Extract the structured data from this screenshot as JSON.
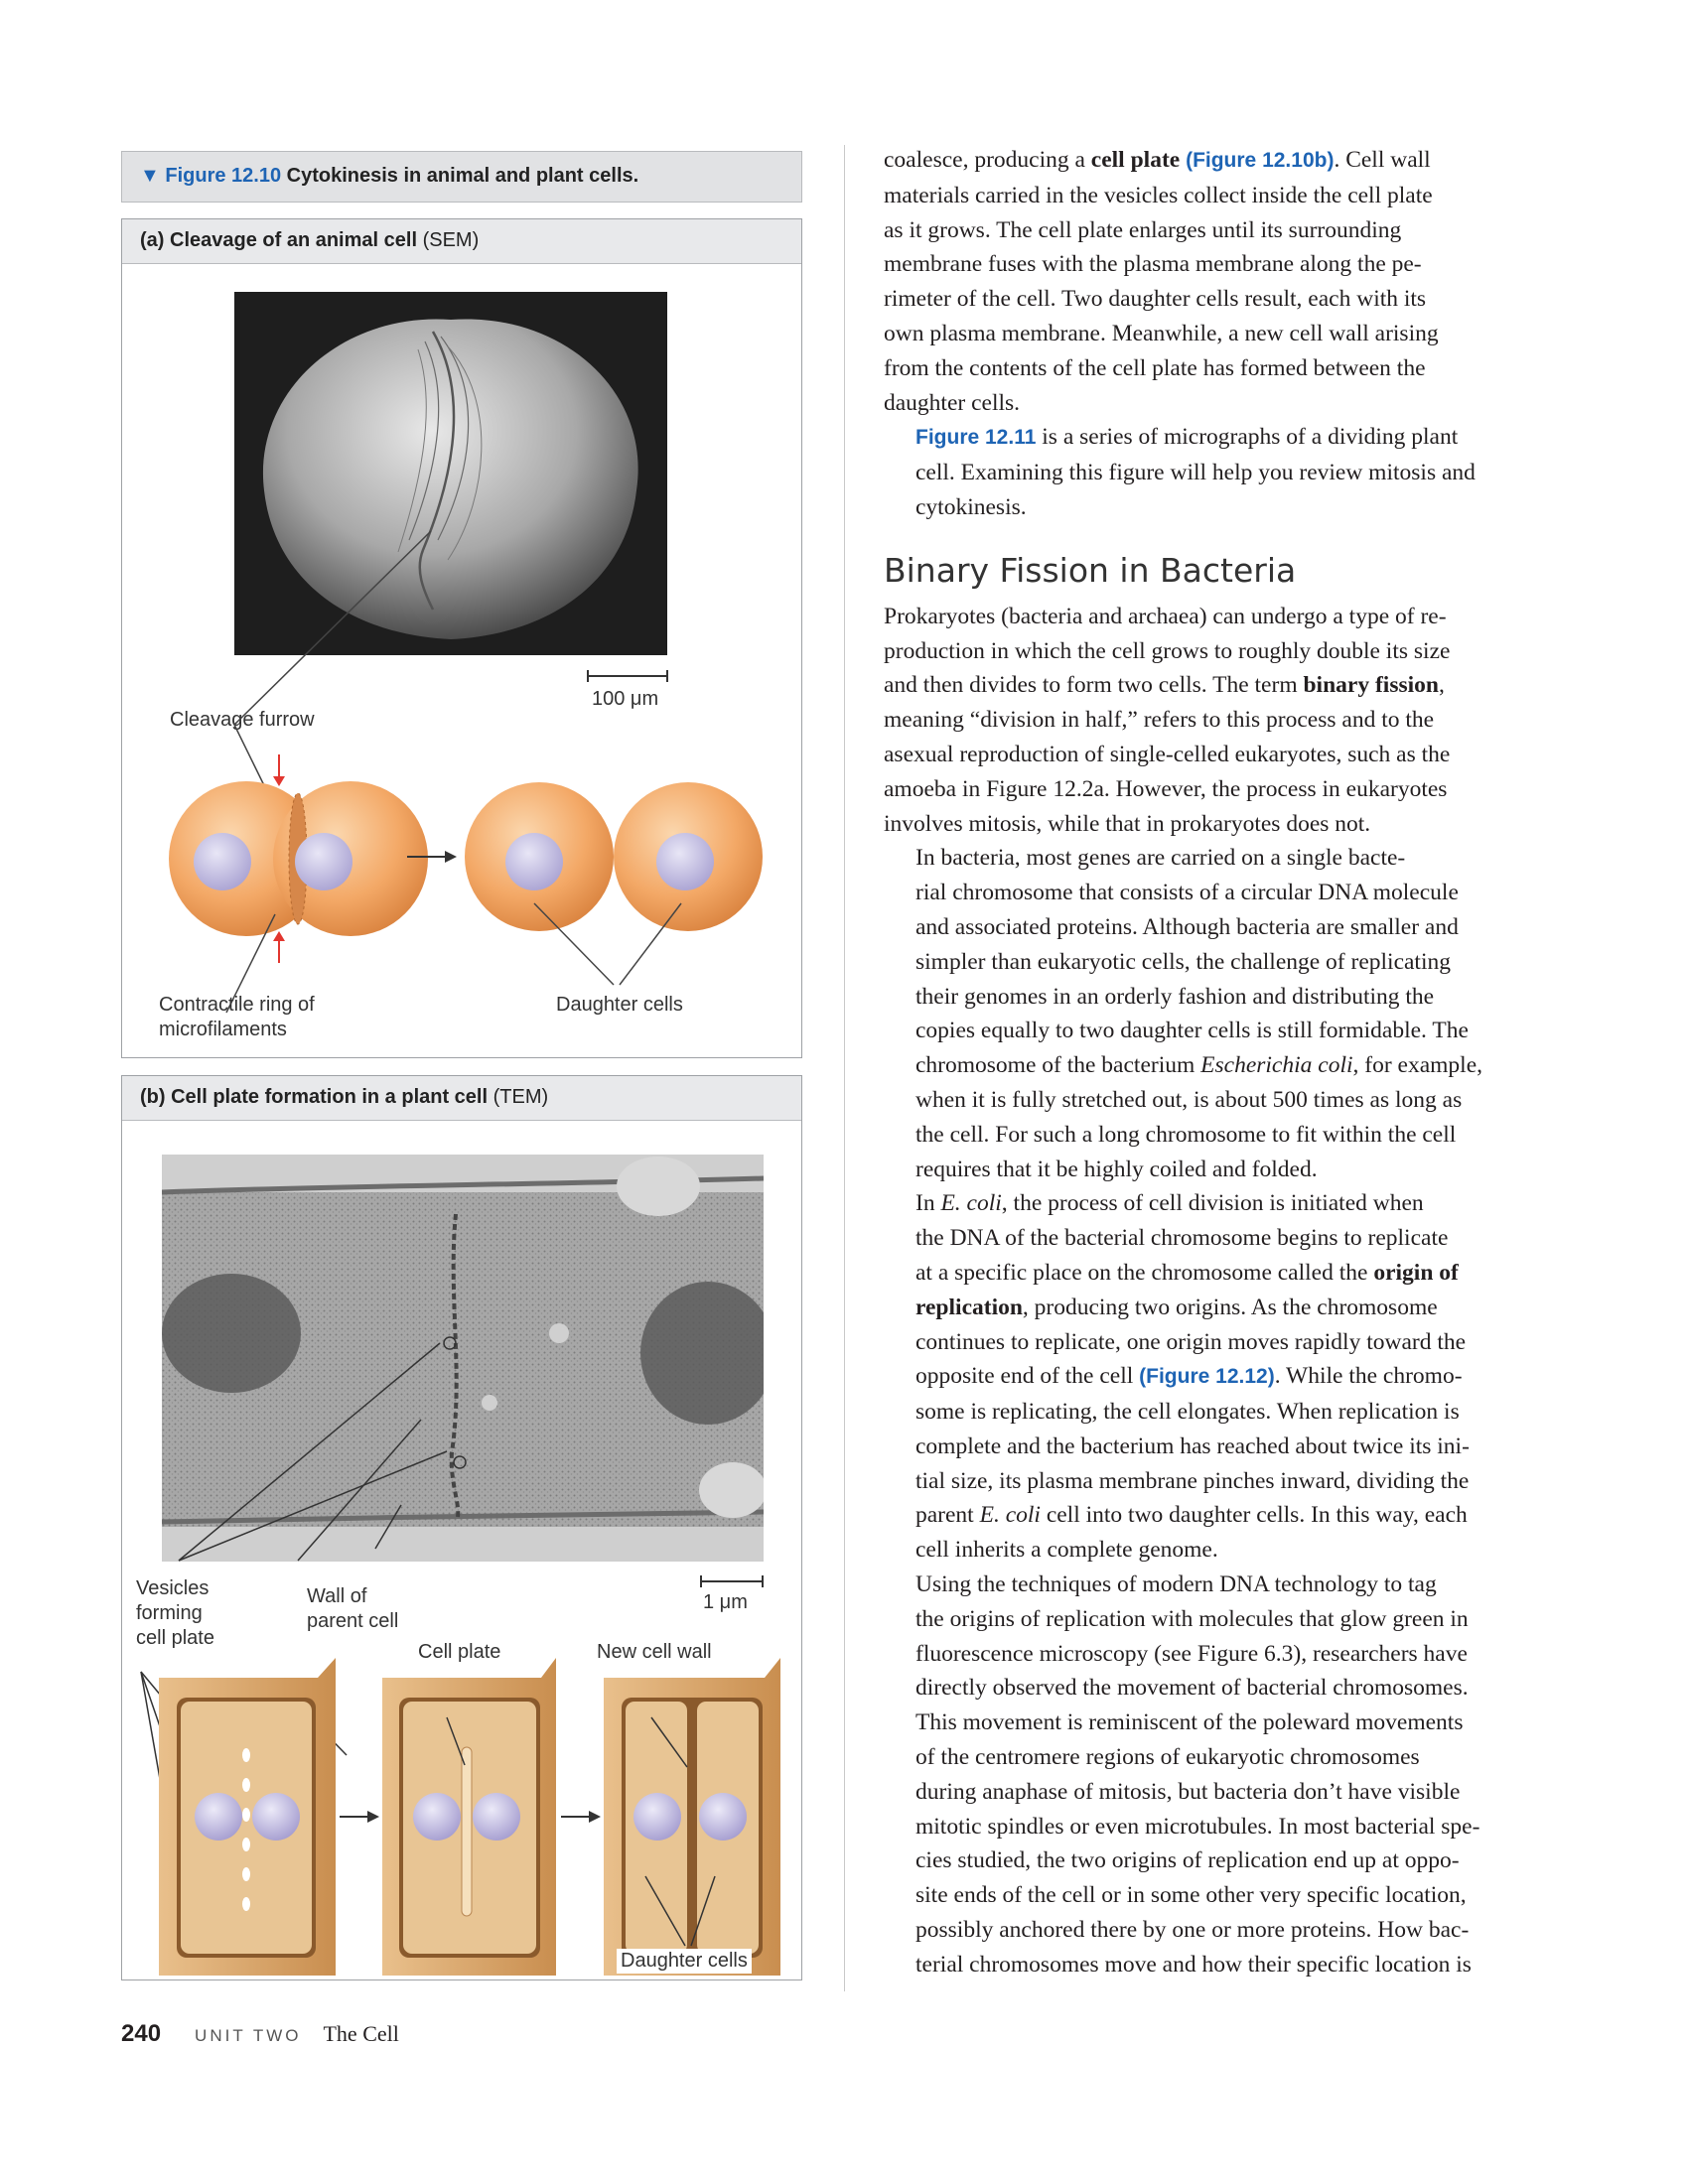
{
  "figure": {
    "arrow_glyph": "▼",
    "number": "Figure 12.10",
    "title": "Cytokinesis in animal and plant cells."
  },
  "panel_a": {
    "title_bold": "(a) Cleavage of an animal cell",
    "title_suffix": "(SEM)",
    "scale_bar": "100 μm",
    "label_cleavage_furrow": "Cleavage furrow",
    "label_contractile_ring_1": "Contractile ring of",
    "label_contractile_ring_2": "microfilaments",
    "label_daughter_cells": "Daughter cells"
  },
  "panel_b": {
    "title_bold": "(b) Cell plate formation in a plant cell",
    "title_suffix": "(TEM)",
    "scale_bar": "1 μm",
    "label_vesicles_1": "Vesicles",
    "label_vesicles_2": "forming",
    "label_vesicles_3": "cell plate",
    "label_wall_1": "Wall of",
    "label_wall_2": "parent cell",
    "label_cell_plate": "Cell plate",
    "label_new_cell_wall": "New cell wall",
    "label_daughter_cells": "Daughter cells"
  },
  "colors": {
    "accent_blue": "#1e64b4",
    "animal_cell": "#f0a25e",
    "nucleus": "#bdb7dc",
    "plant_wall": "#d9a86b",
    "red_arrow": "#e2362f"
  },
  "body": {
    "p1": [
      [
        "coalesce, producing a ",
        {
          "b": "cell plate"
        },
        " ",
        {
          "ref": "(Figure 12.10b)"
        },
        ". Cell wall"
      ],
      [
        "materials carried in the vesicles collect inside the cell plate"
      ],
      [
        "as it grows. The cell plate enlarges until its surrounding"
      ],
      [
        "membrane fuses with the plasma membrane along the pe-"
      ],
      [
        "rimeter of the cell. Two daughter cells result, each with its"
      ],
      [
        "own plasma membrane. Meanwhile, a new cell wall arising"
      ],
      [
        "from the contents of the cell plate has formed between the"
      ],
      [
        "daughter cells."
      ]
    ],
    "p2": [
      [
        {
          "ref": "Figure 12.11"
        },
        " is a series of micrographs of a dividing plant"
      ],
      [
        "cell. Examining this figure will help you review mitosis and"
      ],
      [
        "cytokinesis."
      ]
    ],
    "heading": "Binary Fission in Bacteria",
    "p3": [
      [
        "Prokaryotes (bacteria and archaea) can undergo a type of re-"
      ],
      [
        "production in which the cell grows to roughly double its size"
      ],
      [
        "and then divides to form two cells. The term ",
        {
          "b": "binary fission"
        },
        ","
      ],
      [
        "meaning “division in half,” refers to this process and to the"
      ],
      [
        "asexual reproduction of single-celled eukaryotes, such as the"
      ],
      [
        "amoeba in Figure 12.2a. However, the process in eukaryotes"
      ],
      [
        "involves mitosis, while that in prokaryotes does not."
      ]
    ],
    "p4": [
      [
        "In bacteria, most genes are carried on a single bacte-"
      ],
      [
        "rial chromosome that consists of a circular DNA molecule"
      ],
      [
        "and associated proteins. Although bacteria are smaller and"
      ],
      [
        "simpler than eukaryotic cells, the challenge of replicating"
      ],
      [
        "their genomes in an orderly fashion and distributing the"
      ],
      [
        "copies equally to two daughter cells is still formidable. The"
      ],
      [
        "chromosome of the bacterium ",
        {
          "i": "Escherichia coli"
        },
        ", for example,"
      ],
      [
        "when it is fully stretched out, is about 500 times as long as"
      ],
      [
        "the cell. For such a long chromosome to fit within the cell"
      ],
      [
        "requires that it be highly coiled and folded."
      ]
    ],
    "p5": [
      [
        "In ",
        {
          "i": "E. coli"
        },
        ", the process of cell division is initiated when"
      ],
      [
        "the DNA of the bacterial chromosome begins to replicate"
      ],
      [
        "at a specific place on the chromosome called the ",
        {
          "b": "origin of"
        }
      ],
      [
        {
          "b": "replication"
        },
        ", producing two origins. As the chromosome"
      ],
      [
        "continues to replicate, one origin moves rapidly toward the"
      ],
      [
        "opposite end of the cell ",
        {
          "ref": "(Figure 12.12)"
        },
        ". While the chromo-"
      ],
      [
        "some is replicating, the cell elongates. When replication is"
      ],
      [
        "complete and the bacterium has reached about twice its ini-"
      ],
      [
        "tial size, its plasma membrane pinches inward, dividing the"
      ],
      [
        "parent ",
        {
          "i": "E. coli"
        },
        " cell into two daughter cells. In this way, each"
      ],
      [
        "cell inherits a complete genome."
      ]
    ],
    "p6": [
      [
        "Using the techniques of modern DNA technology to tag"
      ],
      [
        "the origins of replication with molecules that glow green in"
      ],
      [
        "fluorescence microscopy (see Figure 6.3), researchers have"
      ],
      [
        "directly observed the movement of bacterial chromosomes."
      ],
      [
        "This movement is reminiscent of the poleward movements"
      ],
      [
        "of the centromere regions of eukaryotic chromosomes"
      ],
      [
        "during anaphase of mitosis, but bacteria don’t have visible"
      ],
      [
        "mitotic spindles or even microtubules. In most bacterial spe-"
      ],
      [
        "cies studied, the two origins of replication end up at oppo-"
      ],
      [
        "site ends of the cell or in some other very specific location,"
      ],
      [
        "possibly anchored there by one or more proteins. How bac-"
      ],
      [
        "terial chromosomes move and how their specific location is"
      ]
    ]
  },
  "footer": {
    "page_number": "240",
    "unit": "UNIT TWO",
    "unit_title": "The Cell"
  }
}
